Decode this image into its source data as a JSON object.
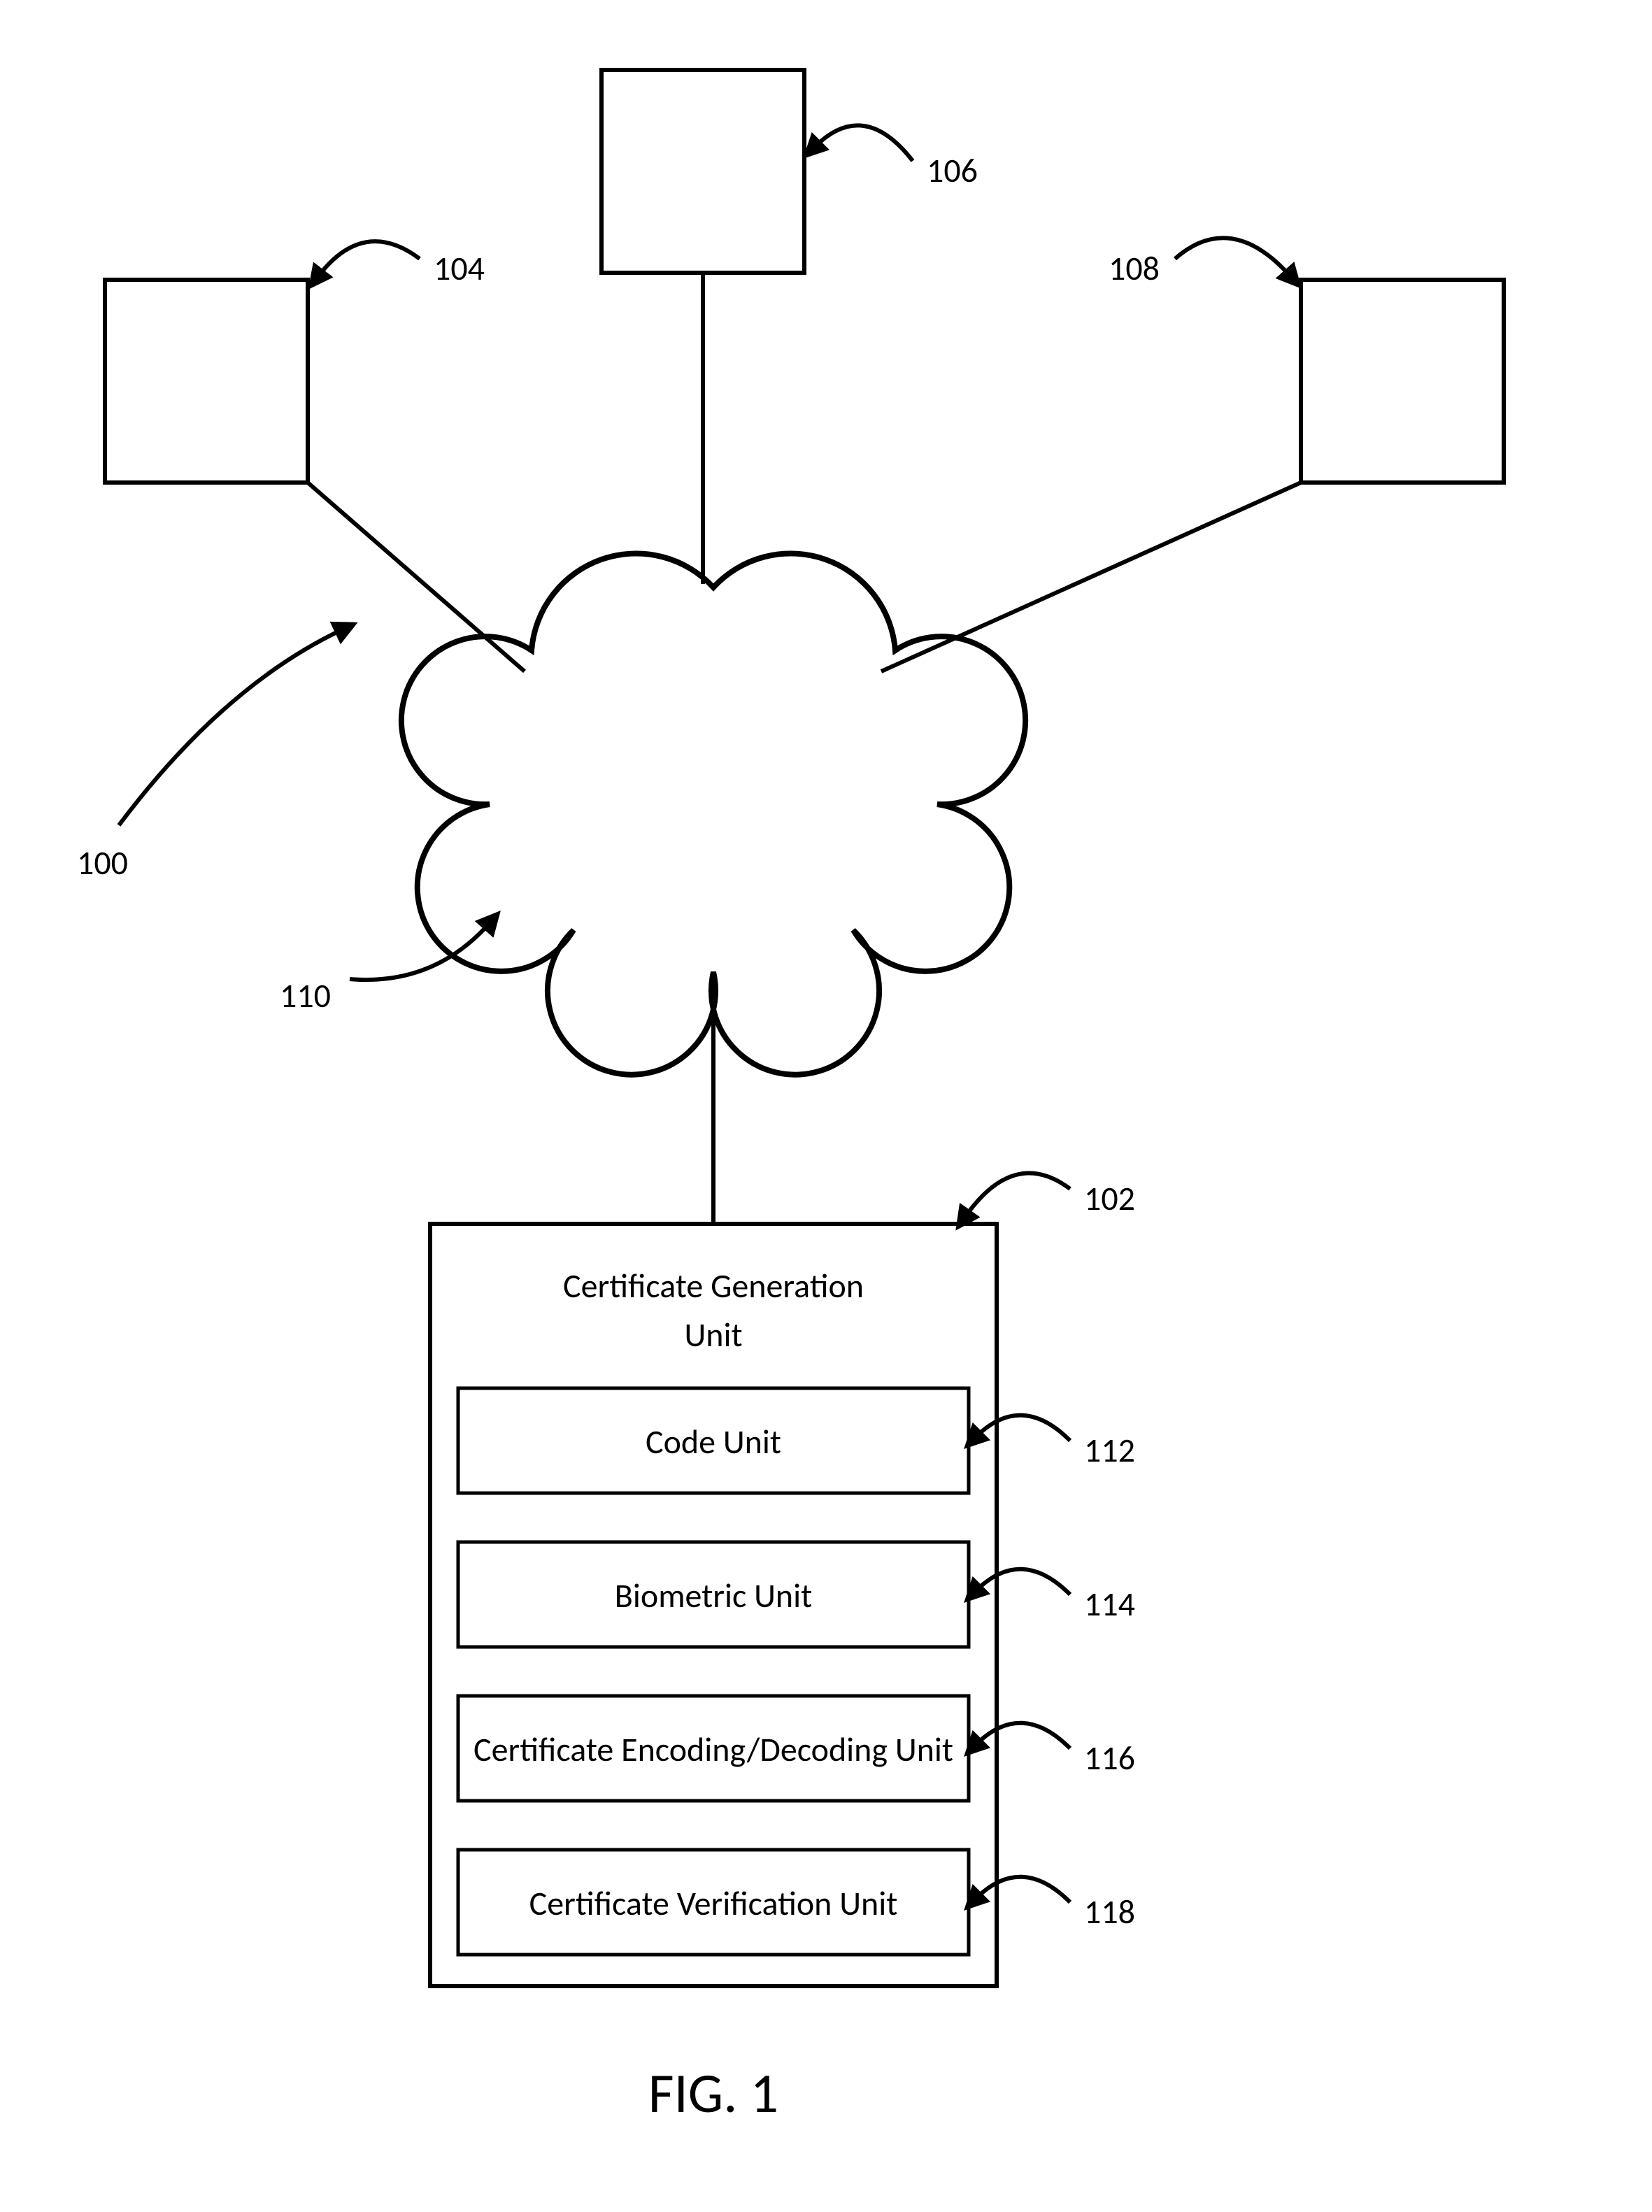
{
  "diagram": {
    "figure_label": "FIG. 1",
    "refs": {
      "r100": "100",
      "r102": "102",
      "r104": "104",
      "r106": "106",
      "r108": "108",
      "r110": "110",
      "r112": "112",
      "r114": "114",
      "r116": "116",
      "r118": "118"
    },
    "main_box": {
      "title_line1": "Certificate Generation",
      "title_line2": "Unit"
    },
    "sub_boxes": {
      "b112": "Code Unit",
      "b114": "Biometric Unit",
      "b116": "Certificate Encoding/Decoding  Unit",
      "b118": "Certificate Verification Unit"
    }
  }
}
